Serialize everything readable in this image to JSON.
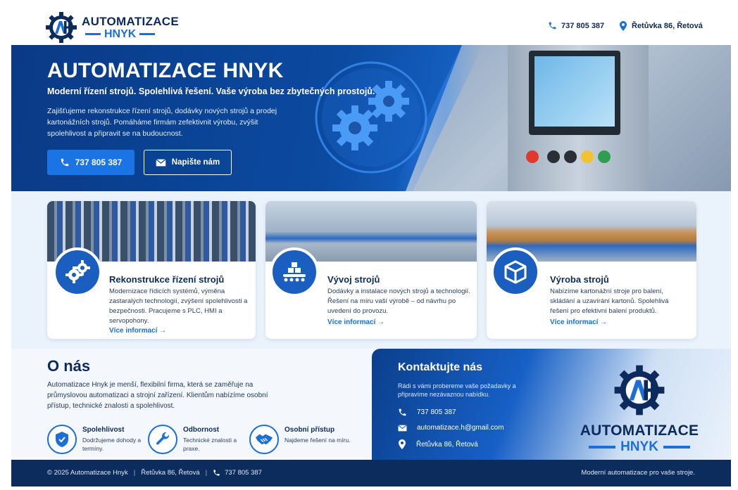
{
  "brand": {
    "line1": "AUTOMATIZACE",
    "line2": "HNYK"
  },
  "header": {
    "phone": "737 805 387",
    "address": "Řetůvka 86, Řetová"
  },
  "hero": {
    "title": "AUTOMATIZACE HNYK",
    "subtitle": "Moderní řízení strojů. Spolehlivá řešení. Vaše výroba bez zbytečných prostojů.",
    "description": "Zajišťujeme rekonstrukce řízení strojů, dodávky nových strojů a prodej kartonážních strojů. Pomáháme firmám zefektivnit výrobu, zvýšit spolehlivost a připravit se na budoucnost.",
    "phone_button": "737 805 387",
    "write_button": "Napište nám"
  },
  "services": [
    {
      "title": "Rekonstrukce řízení strojů",
      "text": "Modernizace řídicích systémů, výměna zastaralých technologií, zvýšení spolehlivosti a bezpečnosti. Pracujeme s PLC, HMI a servopohony.",
      "more": "Více informací →"
    },
    {
      "title": "Vývoj strojů",
      "text": "Dodávky a instalace nových strojů a technologií. Řešení na míru vaší výrobě – od návrhu po uvedení do provozu.",
      "more": "Více informací →"
    },
    {
      "title": "Výroba strojů",
      "text": "Nabízíme kartonážní stroje pro balení, skládání a uzavírání kartonů. Spolehlivá řešení pro efektivní balení produktů.",
      "more": "Více informací →"
    }
  ],
  "about": {
    "title": "O nás",
    "text": "Automatizace Hnyk je menší, flexibilní firma, která se zaměřuje na průmyslovou automatizaci a strojní zařízení. Klientům nabízíme osobní přístup, technické znalosti a spolehlivost.",
    "features": [
      {
        "title": "Spolehlivost",
        "text": "Dodržujeme dohody a termíny."
      },
      {
        "title": "Odbornost",
        "text": "Technické znalosti a praxe."
      },
      {
        "title": "Osobní přístup",
        "text": "Najdeme řešení na míru."
      }
    ]
  },
  "contact": {
    "title": "Kontaktujte nás",
    "text": "Rádi s vámi probereme vaše požadavky a připravíme nezávaznou nabídku.",
    "phone": "737 805 387",
    "email": "automatizace.h@gmail.com",
    "address": "Řetůvka 86, Řetová"
  },
  "footer": {
    "copyright": "© 2025 Automatizace Hnyk",
    "address": "Řetůvka 86, Řetová",
    "phone": "737 805 387",
    "tagline": "Moderní automatizace pro vaše stroje."
  },
  "colors": {
    "primary": "#1b6fd8",
    "dark": "#0d2a5c",
    "footer": "#0c2c5e"
  }
}
